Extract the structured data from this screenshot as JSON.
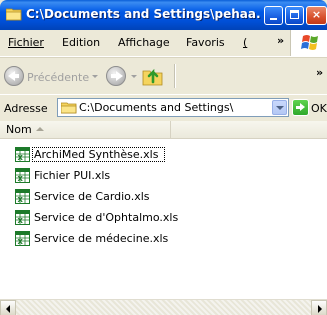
{
  "window": {
    "title": "C:\\Documents and Settings\\pehaa...",
    "buttons": {
      "minimize": "minimize",
      "maximize": "maximize",
      "close": "×"
    }
  },
  "menubar": {
    "items": [
      {
        "label": "Fichier"
      },
      {
        "label": "Edition"
      },
      {
        "label": "Affichage"
      },
      {
        "label": "Favoris"
      },
      {
        "label": "("
      }
    ],
    "overflow": "»"
  },
  "toolbar": {
    "back_label": "Précédente",
    "overflow": "»"
  },
  "addressbar": {
    "label": "Adresse",
    "value": "C:\\Documents and Settings\\",
    "go_label": "OK"
  },
  "list": {
    "column_name": "Nom",
    "files": [
      {
        "name": "ArchiMed Synthèse.xls",
        "selected": true
      },
      {
        "name": "Fichier PUI.xls",
        "selected": false
      },
      {
        "name": "Service de Cardio.xls",
        "selected": false
      },
      {
        "name": "Service de d'Ophtalmo.xls",
        "selected": false
      },
      {
        "name": "Service de médecine.xls",
        "selected": false
      }
    ]
  },
  "colors": {
    "titlebar": "#0054e3",
    "chrome": "#ece9d8",
    "excel_green": "#1d7a2a"
  }
}
